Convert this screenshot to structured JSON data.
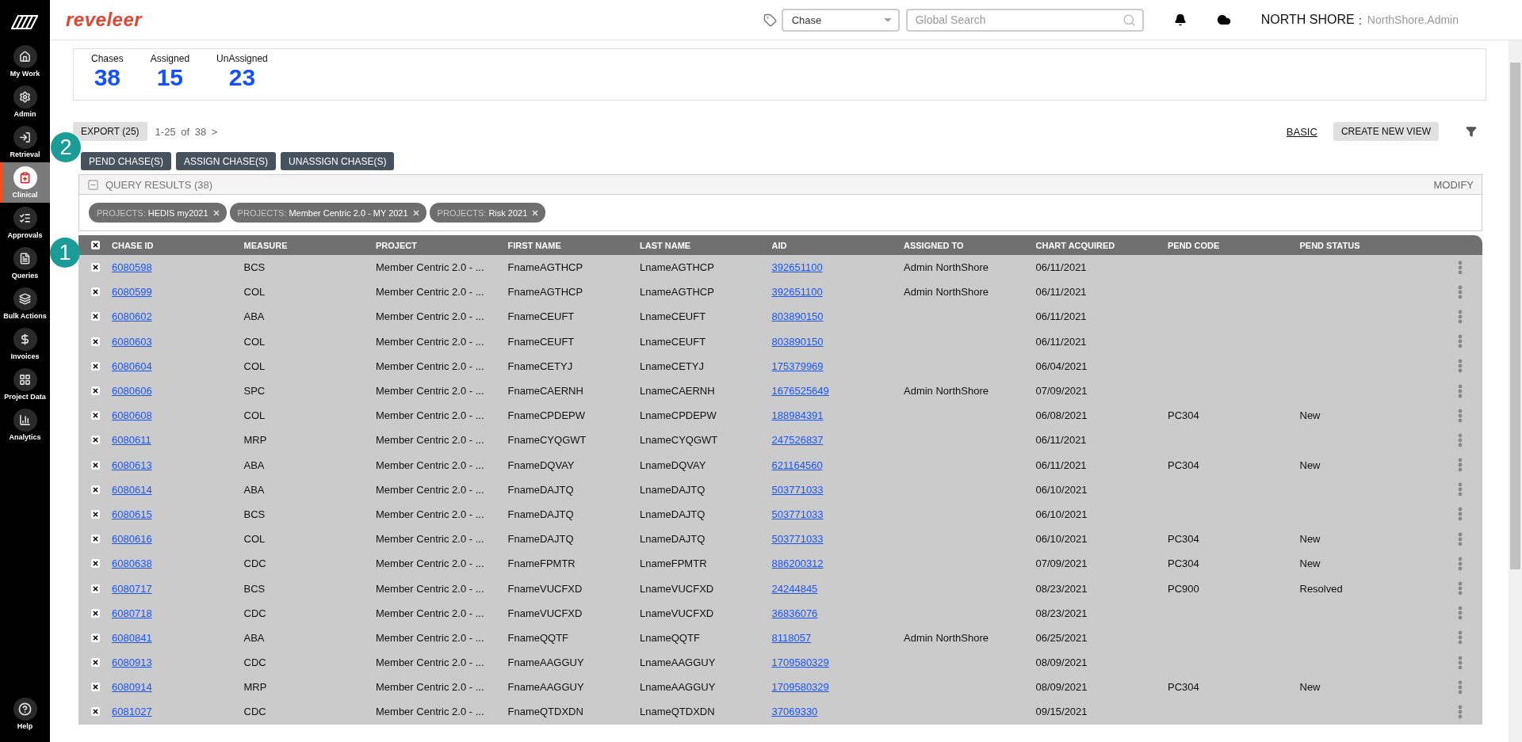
{
  "brand": "reveleer",
  "sidebar": {
    "items": [
      {
        "label": "My Work",
        "selected": false
      },
      {
        "label": "Admin",
        "selected": false
      },
      {
        "label": "Retrieval",
        "selected": false
      },
      {
        "label": "Clinical",
        "selected": true
      },
      {
        "label": "Approvals",
        "selected": false
      },
      {
        "label": "Queries",
        "selected": false
      },
      {
        "label": "Bulk Actions",
        "selected": false
      },
      {
        "label": "Invoices",
        "selected": false
      },
      {
        "label": "Project Data",
        "selected": false
      },
      {
        "label": "Analytics",
        "selected": false
      }
    ],
    "help": "Help"
  },
  "topbar": {
    "search_type": "Chase",
    "search": {
      "placeholder": "Global Search"
    },
    "org": "NORTH SHORE",
    "separator": ":",
    "user": "NorthShore.Admin"
  },
  "stats": [
    {
      "label": "Chases",
      "value": "38"
    },
    {
      "label": "Assigned",
      "value": "15"
    },
    {
      "label": "UnAssigned",
      "value": "23"
    }
  ],
  "toolbar": {
    "export": "EXPORT (25)",
    "pager": "1-25 of 38 >",
    "view": "BASIC",
    "create_view": "CREATE NEW VIEW"
  },
  "actions": [
    "PEND CHASE(S)",
    "ASSIGN CHASE(S)",
    "UNASSIGN CHASE(S)"
  ],
  "query": {
    "title": "QUERY RESULTS (38)",
    "modify": "MODIFY",
    "chips": [
      {
        "label": "PROJECTS:",
        "value": "HEDIS my2021"
      },
      {
        "label": "PROJECTS:",
        "value": "Member Centric 2.0 - MY 2021"
      },
      {
        "label": "PROJECTS:",
        "value": "Risk 2021"
      }
    ]
  },
  "annotations": [
    {
      "label": "2"
    },
    {
      "label": "1"
    }
  ],
  "table": {
    "all_selected": true,
    "columns": [
      {
        "label": "CHASE ID",
        "kind": "link"
      },
      {
        "label": "MEASURE",
        "kind": "text"
      },
      {
        "label": "PROJECT",
        "kind": "text"
      },
      {
        "label": "FIRST NAME",
        "kind": "text"
      },
      {
        "label": "LAST NAME",
        "kind": "text"
      },
      {
        "label": "AID",
        "kind": "link"
      },
      {
        "label": "ASSIGNED TO",
        "kind": "text"
      },
      {
        "label": "CHART ACQUIRED",
        "kind": "text"
      },
      {
        "label": "PEND CODE",
        "kind": "text"
      },
      {
        "label": "PEND STATUS",
        "kind": "text"
      }
    ],
    "rows": [
      {
        "selected": true,
        "chase_id": "6080598",
        "measure": "BCS",
        "project": "Member Centric 2.0 - ...",
        "first_name": "FnameAGTHCP",
        "last_name": "LnameAGTHCP",
        "aid": "392651100",
        "assigned_to": "Admin NorthShore",
        "chart_acquired": "06/11/2021"
      },
      {
        "selected": true,
        "chase_id": "6080599",
        "measure": "COL",
        "project": "Member Centric 2.0 - ...",
        "first_name": "FnameAGTHCP",
        "last_name": "LnameAGTHCP",
        "aid": "392651100",
        "assigned_to": "Admin NorthShore",
        "chart_acquired": "06/11/2021"
      },
      {
        "selected": true,
        "chase_id": "6080602",
        "measure": "ABA",
        "project": "Member Centric 2.0 - ...",
        "first_name": "FnameCEUFT",
        "last_name": "LnameCEUFT",
        "aid": "803890150",
        "chart_acquired": "06/11/2021"
      },
      {
        "selected": true,
        "chase_id": "6080603",
        "measure": "COL",
        "project": "Member Centric 2.0 - ...",
        "first_name": "FnameCEUFT",
        "last_name": "LnameCEUFT",
        "aid": "803890150",
        "chart_acquired": "06/11/2021"
      },
      {
        "selected": true,
        "chase_id": "6080604",
        "measure": "COL",
        "project": "Member Centric 2.0 - ...",
        "first_name": "FnameCETYJ",
        "last_name": "LnameCETYJ",
        "aid": "175379969",
        "chart_acquired": "06/04/2021"
      },
      {
        "selected": true,
        "chase_id": "6080606",
        "measure": "SPC",
        "project": "Member Centric 2.0 - ...",
        "first_name": "FnameCAERNH",
        "last_name": "LnameCAERNH",
        "aid": "1676525649",
        "assigned_to": "Admin NorthShore",
        "chart_acquired": "07/09/2021"
      },
      {
        "selected": true,
        "chase_id": "6080608",
        "measure": "COL",
        "project": "Member Centric 2.0 - ...",
        "first_name": "FnameCPDEPW",
        "last_name": "LnameCPDEPW",
        "aid": "188984391",
        "chart_acquired": "06/08/2021",
        "pend_code": "PC304",
        "pend_status": "New"
      },
      {
        "selected": true,
        "chase_id": "6080611",
        "measure": "MRP",
        "project": "Member Centric 2.0 - ...",
        "first_name": "FnameCYQGWT",
        "last_name": "LnameCYQGWT",
        "aid": "247526837",
        "chart_acquired": "06/11/2021"
      },
      {
        "selected": true,
        "chase_id": "6080613",
        "measure": "ABA",
        "project": "Member Centric 2.0 - ...",
        "first_name": "FnameDQVAY",
        "last_name": "LnameDQVAY",
        "aid": "621164560",
        "chart_acquired": "06/11/2021",
        "pend_code": "PC304",
        "pend_status": "New"
      },
      {
        "selected": true,
        "chase_id": "6080614",
        "measure": "ABA",
        "project": "Member Centric 2.0 - ...",
        "first_name": "FnameDAJTQ",
        "last_name": "LnameDAJTQ",
        "aid": "503771033",
        "chart_acquired": "06/10/2021"
      },
      {
        "selected": true,
        "chase_id": "6080615",
        "measure": "BCS",
        "project": "Member Centric 2.0 - ...",
        "first_name": "FnameDAJTQ",
        "last_name": "LnameDAJTQ",
        "aid": "503771033",
        "chart_acquired": "06/10/2021"
      },
      {
        "selected": true,
        "chase_id": "6080616",
        "measure": "COL",
        "project": "Member Centric 2.0 - ...",
        "first_name": "FnameDAJTQ",
        "last_name": "LnameDAJTQ",
        "aid": "503771033",
        "chart_acquired": "06/10/2021",
        "pend_code": "PC304",
        "pend_status": "New"
      },
      {
        "selected": true,
        "chase_id": "6080638",
        "measure": "CDC",
        "project": "Member Centric 2.0 - ...",
        "first_name": "FnameFPMTR",
        "last_name": "LnameFPMTR",
        "aid": "886200312",
        "chart_acquired": "07/09/2021",
        "pend_code": "PC304",
        "pend_status": "New"
      },
      {
        "selected": true,
        "chase_id": "6080717",
        "measure": "BCS",
        "project": "Member Centric 2.0 - ...",
        "first_name": "FnameVUCFXD",
        "last_name": "LnameVUCFXD",
        "aid": "24244845",
        "chart_acquired": "08/23/2021",
        "pend_code": "PC900",
        "pend_status": "Resolved"
      },
      {
        "selected": true,
        "chase_id": "6080718",
        "measure": "CDC",
        "project": "Member Centric 2.0 - ...",
        "first_name": "FnameVUCFXD",
        "last_name": "LnameVUCFXD",
        "aid": "36836076",
        "chart_acquired": "08/23/2021"
      },
      {
        "selected": true,
        "chase_id": "6080841",
        "measure": "ABA",
        "project": "Member Centric 2.0 - ...",
        "first_name": "FnameQQTF",
        "last_name": "LnameQQTF",
        "aid": "8118057",
        "assigned_to": "Admin NorthShore",
        "chart_acquired": "06/25/2021"
      },
      {
        "selected": true,
        "chase_id": "6080913",
        "measure": "CDC",
        "project": "Member Centric 2.0 - ...",
        "first_name": "FnameAAGGUY",
        "last_name": "LnameAAGGUY",
        "aid": "1709580329",
        "chart_acquired": "08/09/2021"
      },
      {
        "selected": true,
        "chase_id": "6080914",
        "measure": "MRP",
        "project": "Member Centric 2.0 - ...",
        "first_name": "FnameAAGGUY",
        "last_name": "LnameAAGGUY",
        "aid": "1709580329",
        "chart_acquired": "08/09/2021",
        "pend_code": "PC304",
        "pend_status": "New"
      },
      {
        "selected": true,
        "chase_id": "6081027",
        "measure": "CDC",
        "project": "Member Centric 2.0 - ...",
        "first_name": "FnameQTDXDN",
        "last_name": "LnameQTDXDN",
        "aid": "37069330",
        "chart_acquired": "09/15/2021"
      }
    ]
  }
}
